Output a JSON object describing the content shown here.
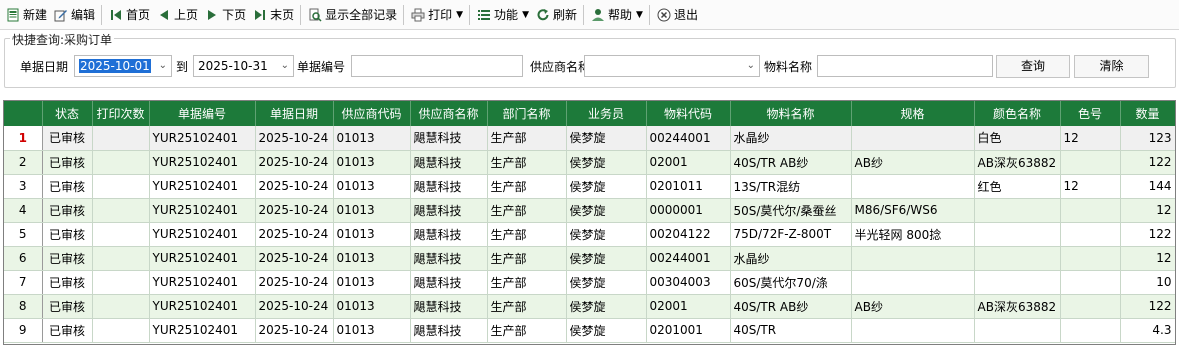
{
  "toolbar": {
    "new": "新建",
    "edit": "编辑",
    "first": "首页",
    "prev": "上页",
    "next": "下页",
    "last": "末页",
    "show_all": "显示全部记录",
    "print": "打印",
    "function": "功能",
    "refresh": "刷新",
    "help": "帮助",
    "exit": "退出"
  },
  "query": {
    "title": "快捷查询:采购订单",
    "date_label": "单据日期",
    "date_from": "2025-10-01",
    "to_label": "到",
    "date_to": "2025-10-31",
    "doc_no_label": "单据编号",
    "doc_no_value": "",
    "supplier_label": "供应商名称",
    "supplier_value": "",
    "material_label": "物料名称",
    "material_value": "",
    "search_button": "查询",
    "clear_button": "清除"
  },
  "grid": {
    "columns": [
      "状态",
      "打印次数",
      "单据编号",
      "单据日期",
      "供应商代码",
      "供应商名称",
      "部门名称",
      "业务员",
      "物料代码",
      "物料名称",
      "规格",
      "颜色名称",
      "色号",
      "数量"
    ],
    "rows": [
      {
        "n": "1",
        "status": "已审核",
        "prints": "",
        "doc": "YUR25102401",
        "date": "2025-10-24",
        "sup_code": "01013",
        "sup_name": "飓慧科技",
        "dept": "生产部",
        "staff": "侯梦旋",
        "mat_code": "00244001",
        "mat_name": "水晶纱",
        "spec": "",
        "color": "白色",
        "color_no": "12",
        "qty": "123"
      },
      {
        "n": "2",
        "status": "已审核",
        "prints": "",
        "doc": "YUR25102401",
        "date": "2025-10-24",
        "sup_code": "01013",
        "sup_name": "飓慧科技",
        "dept": "生产部",
        "staff": "侯梦旋",
        "mat_code": "02001",
        "mat_name": "40S/TR AB纱",
        "spec": "AB纱",
        "color": "AB深灰63882",
        "color_no": "",
        "qty": "122"
      },
      {
        "n": "3",
        "status": "已审核",
        "prints": "",
        "doc": "YUR25102401",
        "date": "2025-10-24",
        "sup_code": "01013",
        "sup_name": "飓慧科技",
        "dept": "生产部",
        "staff": "侯梦旋",
        "mat_code": "0201011",
        "mat_name": "13S/TR混纺",
        "spec": "",
        "color": "红色",
        "color_no": "12",
        "qty": "144"
      },
      {
        "n": "4",
        "status": "已审核",
        "prints": "",
        "doc": "YUR25102401",
        "date": "2025-10-24",
        "sup_code": "01013",
        "sup_name": "飓慧科技",
        "dept": "生产部",
        "staff": "侯梦旋",
        "mat_code": "0000001",
        "mat_name": "50S/莫代尔/桑蚕丝",
        "spec": "M86/SF6/WS6",
        "color": "",
        "color_no": "",
        "qty": "12"
      },
      {
        "n": "5",
        "status": "已审核",
        "prints": "",
        "doc": "YUR25102401",
        "date": "2025-10-24",
        "sup_code": "01013",
        "sup_name": "飓慧科技",
        "dept": "生产部",
        "staff": "侯梦旋",
        "mat_code": "00204122",
        "mat_name": "75D/72F-Z-800T",
        "spec": "半光轻网  800捻",
        "color": "",
        "color_no": "",
        "qty": "122"
      },
      {
        "n": "6",
        "status": "已审核",
        "prints": "",
        "doc": "YUR25102401",
        "date": "2025-10-24",
        "sup_code": "01013",
        "sup_name": "飓慧科技",
        "dept": "生产部",
        "staff": "侯梦旋",
        "mat_code": "00244001",
        "mat_name": "水晶纱",
        "spec": "",
        "color": "",
        "color_no": "",
        "qty": "12"
      },
      {
        "n": "7",
        "status": "已审核",
        "prints": "",
        "doc": "YUR25102401",
        "date": "2025-10-24",
        "sup_code": "01013",
        "sup_name": "飓慧科技",
        "dept": "生产部",
        "staff": "侯梦旋",
        "mat_code": "00304003",
        "mat_name": "60S/莫代尔70/涤",
        "spec": "",
        "color": "",
        "color_no": "",
        "qty": "10"
      },
      {
        "n": "8",
        "status": "已审核",
        "prints": "",
        "doc": "YUR25102401",
        "date": "2025-10-24",
        "sup_code": "01013",
        "sup_name": "飓慧科技",
        "dept": "生产部",
        "staff": "侯梦旋",
        "mat_code": "02001",
        "mat_name": "40S/TR AB纱",
        "spec": "AB纱",
        "color": "AB深灰63882",
        "color_no": "",
        "qty": "122"
      },
      {
        "n": "9",
        "status": "已审核",
        "prints": "",
        "doc": "YUR25102401",
        "date": "2025-10-24",
        "sup_code": "01013",
        "sup_name": "飓慧科技",
        "dept": "生产部",
        "staff": "侯梦旋",
        "mat_code": "0201001",
        "mat_name": "40S/TR",
        "spec": "",
        "color": "",
        "color_no": "",
        "qty": "4.3"
      }
    ]
  },
  "colors": {
    "header_green": "#1d7a3a",
    "row_alt": "#eaf5e6",
    "selection_blue": "#1f6fd6",
    "current_row_marker": "#d00000"
  }
}
